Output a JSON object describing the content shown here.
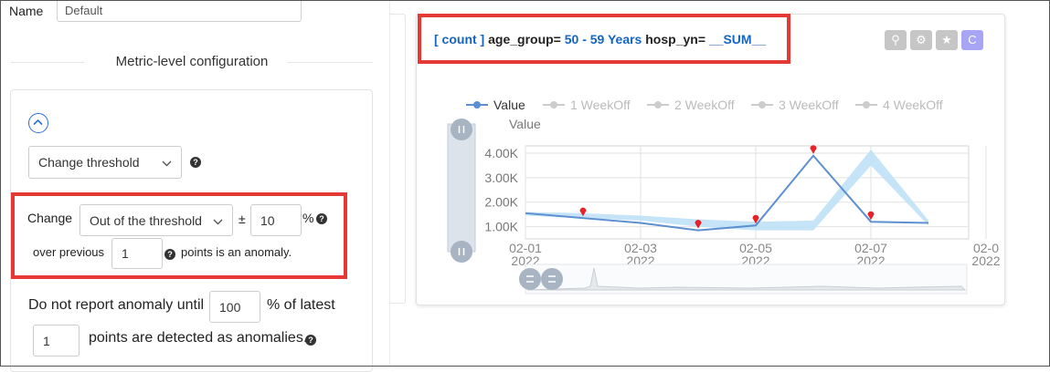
{
  "form": {
    "name_label": "Name",
    "name_value": "Default",
    "section_title": "Metric-level configuration",
    "detection_method": "Change threshold",
    "change_label": "Change",
    "change_direction": "Out of the threshold",
    "plus_minus": "±",
    "change_value": "10",
    "percent_sign": "%",
    "over_previous_label": "over previous",
    "previous_points": "1",
    "points_anomaly_label": "points is an anomaly.",
    "no_report_label": "Do not report anomaly until",
    "latest_percent": "100",
    "percent_latest_label": "% of latest",
    "latest_points": "1",
    "points_detected_label": "points are detected as anomalies.",
    "help_symbol": "?"
  },
  "chart_panel": {
    "header": {
      "count": "[ count ]",
      "k1": "age_group=",
      "v1": "50 - 59 Years",
      "k2": "hosp_yn=",
      "v2": "__SUM__"
    },
    "toolbar": [
      {
        "icon": "person-chart-icon",
        "glyph": "⚲"
      },
      {
        "icon": "user-settings-icon",
        "glyph": "⚙"
      },
      {
        "icon": "star-icon",
        "glyph": "★"
      },
      {
        "icon": "c-icon",
        "glyph": "C"
      }
    ],
    "colors": {
      "accent": "#1565c0",
      "highlight": "#e53935",
      "line": "#5b8fd0",
      "band": "#bfe1f7",
      "anomaly": "#e8222a"
    }
  },
  "chart_data": {
    "type": "line",
    "legend": [
      "Value",
      "1 WeekOff",
      "2 WeekOff",
      "3 WeekOff",
      "4 WeekOff"
    ],
    "ylabel": "Value",
    "yticks": [
      "4.00K",
      "3.00K",
      "2.00K",
      "1.00K"
    ],
    "xticks": [
      {
        "date": "02-01",
        "year": "2022"
      },
      {
        "date": "02-03",
        "year": "2022"
      },
      {
        "date": "02-05",
        "year": "2022"
      },
      {
        "date": "02-07",
        "year": "2022"
      },
      {
        "date": "02-0",
        "year": "2022"
      }
    ],
    "ylim": [
      500,
      4300
    ],
    "x": [
      "2022-02-01",
      "2022-02-02",
      "2022-02-03",
      "2022-02-04",
      "2022-02-05",
      "2022-02-06",
      "2022-02-07",
      "2022-02-08"
    ],
    "series": [
      {
        "name": "Value",
        "values": [
          1550,
          1350,
          1150,
          850,
          1050,
          3900,
          1200,
          1150
        ]
      }
    ],
    "band": {
      "upper": [
        1600,
        1550,
        1450,
        1300,
        1200,
        1250,
        4150,
        1250
      ],
      "lower": [
        1450,
        1350,
        1250,
        1000,
        850,
        850,
        3500,
        1050
      ]
    },
    "anomalies": [
      "2022-02-02",
      "2022-02-04",
      "2022-02-05",
      "2022-02-06",
      "2022-02-07"
    ]
  }
}
